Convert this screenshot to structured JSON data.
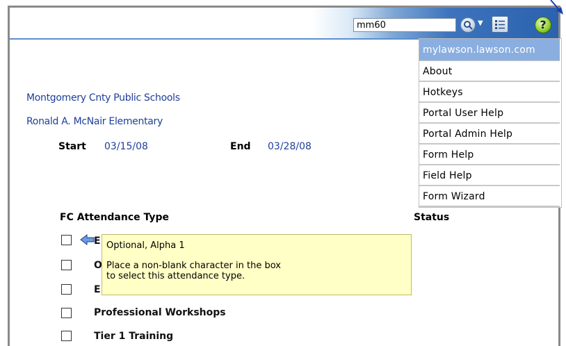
{
  "toolbar": {
    "search_value": "mm60"
  },
  "help_menu": {
    "items": [
      {
        "label": "mylawson.lawson.com"
      },
      {
        "label": "About"
      },
      {
        "label": "Hotkeys"
      },
      {
        "label": "Portal User Help"
      },
      {
        "label": "Portal Admin Help"
      },
      {
        "label": "Form Help"
      },
      {
        "label": "Field Help"
      },
      {
        "label": "Form Wizard"
      }
    ]
  },
  "form": {
    "district": "Montgomery Cnty Public Schools",
    "school": "Ronald A. McNair Elementary",
    "start_label": "Start",
    "start_date": "03/15/08",
    "end_label": "End",
    "end_date": "03/28/08",
    "col_type": "FC Attendance Type",
    "col_status": "Status",
    "rows": [
      {
        "label": "E"
      },
      {
        "label": "O"
      },
      {
        "label": "E"
      },
      {
        "label": "Professional Workshops"
      },
      {
        "label": "Tier 1 Training"
      }
    ]
  },
  "tooltip": {
    "line1": "Optional, Alpha 1",
    "line2": "Place a non-blank character in the box",
    "line3": "to select this attendance type."
  },
  "colors": {
    "link_blue": "#1f3f9a",
    "menu_highlight": "#8aaee0",
    "tooltip_bg": "#ffffc6"
  }
}
